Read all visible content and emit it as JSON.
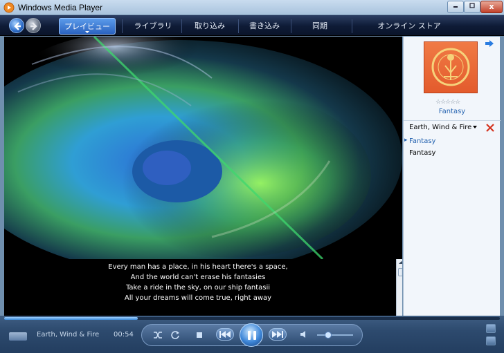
{
  "window": {
    "title": "Windows Media Player",
    "close_glyph": "x"
  },
  "nav": {
    "tabs": [
      {
        "label": "プレイビュー",
        "active": true
      },
      {
        "label": "ライブラリ",
        "active": false
      },
      {
        "label": "取り込み",
        "active": false
      },
      {
        "label": "書き込み",
        "active": false
      },
      {
        "label": "同期",
        "active": false
      },
      {
        "label": "オンライン ストア",
        "active": false
      }
    ]
  },
  "lyrics": {
    "lines": [
      "Every man has a place, in his heart there's a space,",
      "And the world can't erase his fantasies",
      "Take a ride in the sky, on our ship fantasii",
      "All your dreams will come true, right away"
    ]
  },
  "pane": {
    "album_title": "Fantasy",
    "rating_stars": "☆☆☆☆☆",
    "artist": "Earth, Wind & Fire",
    "playlist": [
      {
        "title": "Fantasy",
        "current": true
      },
      {
        "title": "Fantasy",
        "current": false
      }
    ]
  },
  "player": {
    "now_playing": "Earth, Wind & Fire",
    "elapsed": "00:54",
    "seek_progress": 0.27,
    "volume": 0.3
  },
  "colors": {
    "accent": "#2563b0",
    "nav_bg": "#0e1b36",
    "album_art": "#e8623a"
  }
}
